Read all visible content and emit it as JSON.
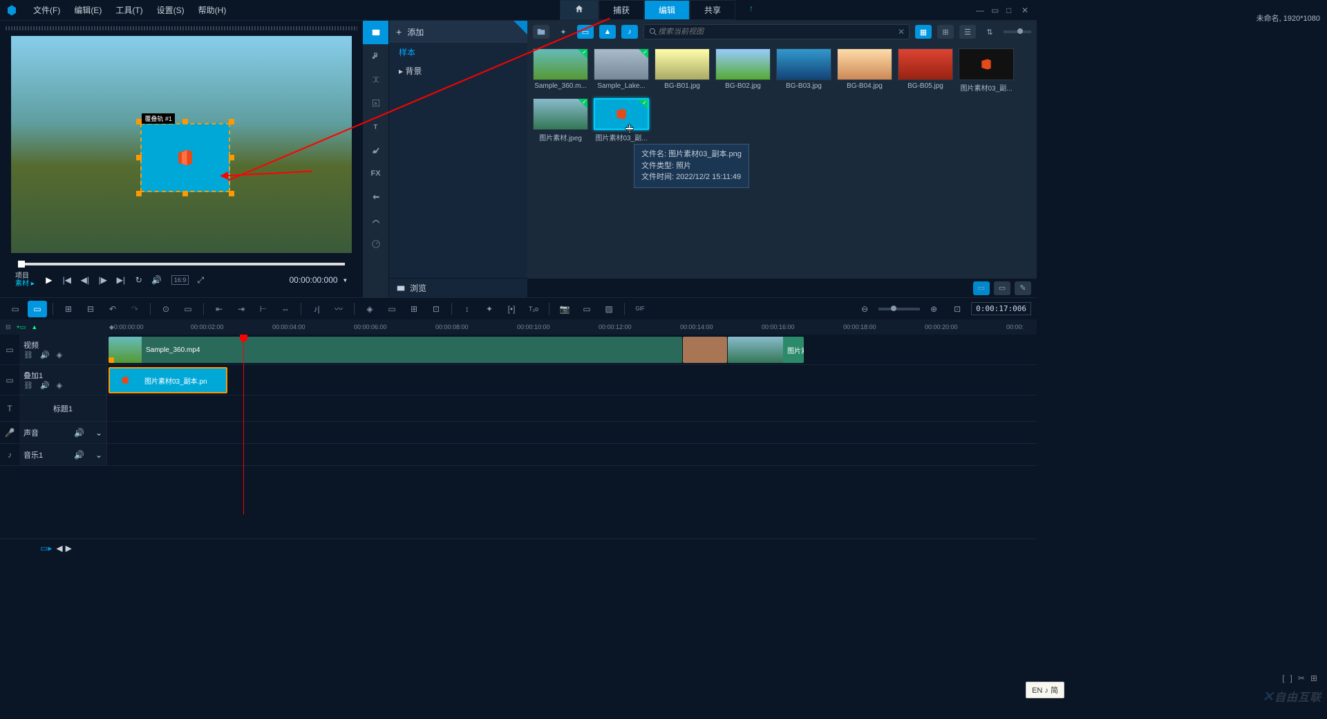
{
  "menu": {
    "file": "文件(F)",
    "edit": "编辑(E)",
    "tools": "工具(T)",
    "settings": "设置(S)",
    "help": "帮助(H)"
  },
  "tabs": {
    "capture": "捕获",
    "edit": "编辑",
    "share": "共享"
  },
  "project_info": "未命名, 1920*1080",
  "preview": {
    "play_label_1": "项目",
    "play_label_2": "素材",
    "overlay_label": "覆叠轨 #1",
    "timecode": "00:00:00:000",
    "aspect": "16:9"
  },
  "add_label": "添加",
  "tree": {
    "sample": "样本",
    "background": "背景"
  },
  "browse_label": "浏览",
  "search_placeholder": "搜索当前视图",
  "thumbs": [
    {
      "name": "Sample_360.m..."
    },
    {
      "name": "Sample_Lake..."
    },
    {
      "name": "BG-B01.jpg"
    },
    {
      "name": "BG-B02.jpg"
    },
    {
      "name": "BG-B03.jpg"
    },
    {
      "name": "BG-B04.jpg"
    },
    {
      "name": "BG-B05.jpg"
    },
    {
      "name": "图片素材03_副..."
    },
    {
      "name": "图片素材.jpeg"
    },
    {
      "name": "图片素材03_副..."
    }
  ],
  "tooltip": {
    "l1": "文件名: 图片素材03_副本.png",
    "l2": "文件类型: 照片",
    "l3": "文件时间: 2022/12/2 15:11:49"
  },
  "timeline": {
    "current_time": "0:00:17:006",
    "ruler": [
      "0:00:00:00",
      "00:00:02:00",
      "00:00:04:00",
      "00:00:06:00",
      "00:00:08:00",
      "00:00:10:00",
      "00:00:12:00",
      "00:00:14:00",
      "00:00:16:00",
      "00:00:18:00",
      "00:00:20:00",
      "00:00:"
    ]
  },
  "tracks": {
    "video": "视频",
    "overlay": "叠加1",
    "title": "标题1",
    "sound": "声音",
    "music": "音乐1"
  },
  "clips": {
    "video1": "Sample_360.mp4",
    "video3": "图片素",
    "overlay": "图片素材03_副本.pn"
  },
  "ime": "EN ♪ 简",
  "watermark": "自由互联"
}
